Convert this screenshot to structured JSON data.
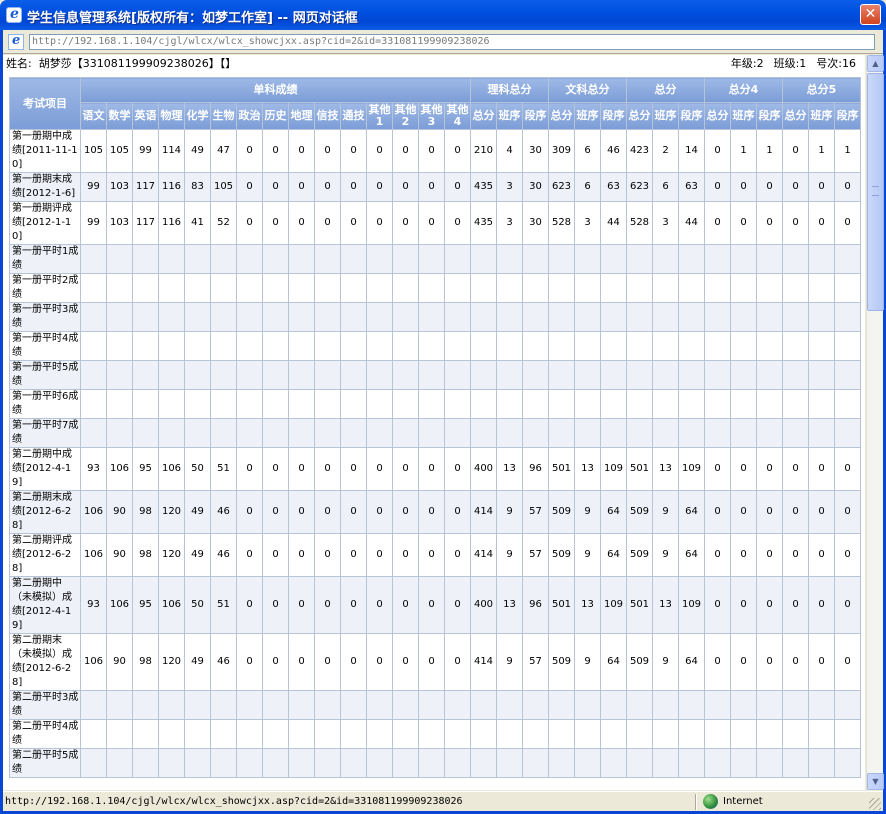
{
  "window": {
    "title": "学生信息管理系统[版权所有：如梦工作室] -- 网页对话框",
    "close_label": "✕"
  },
  "address": {
    "url": "http://192.168.1.104/cjgl/wlcx/wlcx_showcjxx.asp?cid=2&id=331081199909238026"
  },
  "info": {
    "name_label": "姓名:",
    "name_value": "胡梦莎【331081199909238026】【】",
    "grade": "年级:2",
    "class": "班级:1",
    "seat": "号次:16"
  },
  "table": {
    "exam_header": "考试项目",
    "groups": [
      "单科成绩",
      "理科总分",
      "文科总分",
      "总分",
      "总分4",
      "总分5"
    ],
    "subjects": [
      "语文",
      "数学",
      "英语",
      "物理",
      "化学",
      "生物",
      "政治",
      "历史",
      "地理",
      "信技",
      "通技",
      "其他1",
      "其他2",
      "其他3",
      "其他4"
    ],
    "subheads": [
      "总分",
      "班序",
      "段序"
    ],
    "rows": [
      {
        "label": "第一册期中成绩[2011-11-10]",
        "v": [
          "105",
          "105",
          "99",
          "114",
          "49",
          "47",
          "0",
          "0",
          "0",
          "0",
          "0",
          "0",
          "0",
          "0",
          "0",
          "210",
          "4",
          "30",
          "309",
          "6",
          "46",
          "423",
          "2",
          "14",
          "0",
          "1",
          "1",
          "0",
          "1",
          "1"
        ]
      },
      {
        "label": "第一册期末成绩[2012-1-6]",
        "v": [
          "99",
          "103",
          "117",
          "116",
          "83",
          "105",
          "0",
          "0",
          "0",
          "0",
          "0",
          "0",
          "0",
          "0",
          "0",
          "435",
          "3",
          "30",
          "623",
          "6",
          "63",
          "623",
          "6",
          "63",
          "0",
          "0",
          "0",
          "0",
          "0",
          "0"
        ]
      },
      {
        "label": "第一册期评成绩[2012-1-10]",
        "v": [
          "99",
          "103",
          "117",
          "116",
          "41",
          "52",
          "0",
          "0",
          "0",
          "0",
          "0",
          "0",
          "0",
          "0",
          "0",
          "435",
          "3",
          "30",
          "528",
          "3",
          "44",
          "528",
          "3",
          "44",
          "0",
          "0",
          "0",
          "0",
          "0",
          "0"
        ]
      },
      {
        "label": "第一册平时1成绩",
        "v": []
      },
      {
        "label": "第一册平时2成绩",
        "v": []
      },
      {
        "label": "第一册平时3成绩",
        "v": []
      },
      {
        "label": "第一册平时4成绩",
        "v": []
      },
      {
        "label": "第一册平时5成绩",
        "v": []
      },
      {
        "label": "第一册平时6成绩",
        "v": []
      },
      {
        "label": "第一册平时7成绩",
        "v": []
      },
      {
        "label": "第二册期中成绩[2012-4-19]",
        "v": [
          "93",
          "106",
          "95",
          "106",
          "50",
          "51",
          "0",
          "0",
          "0",
          "0",
          "0",
          "0",
          "0",
          "0",
          "0",
          "400",
          "13",
          "96",
          "501",
          "13",
          "109",
          "501",
          "13",
          "109",
          "0",
          "0",
          "0",
          "0",
          "0",
          "0"
        ]
      },
      {
        "label": "第二册期末成绩[2012-6-28]",
        "v": [
          "106",
          "90",
          "98",
          "120",
          "49",
          "46",
          "0",
          "0",
          "0",
          "0",
          "0",
          "0",
          "0",
          "0",
          "0",
          "414",
          "9",
          "57",
          "509",
          "9",
          "64",
          "509",
          "9",
          "64",
          "0",
          "0",
          "0",
          "0",
          "0",
          "0"
        ]
      },
      {
        "label": "第二册期评成绩[2012-6-28]",
        "v": [
          "106",
          "90",
          "98",
          "120",
          "49",
          "46",
          "0",
          "0",
          "0",
          "0",
          "0",
          "0",
          "0",
          "0",
          "0",
          "414",
          "9",
          "57",
          "509",
          "9",
          "64",
          "509",
          "9",
          "64",
          "0",
          "0",
          "0",
          "0",
          "0",
          "0"
        ]
      },
      {
        "label": "第二册期中（未模拟）成绩[2012-4-19]",
        "v": [
          "93",
          "106",
          "95",
          "106",
          "50",
          "51",
          "0",
          "0",
          "0",
          "0",
          "0",
          "0",
          "0",
          "0",
          "0",
          "400",
          "13",
          "96",
          "501",
          "13",
          "109",
          "501",
          "13",
          "109",
          "0",
          "0",
          "0",
          "0",
          "0",
          "0"
        ]
      },
      {
        "label": "第二册期末（未模拟）成绩[2012-6-28]",
        "v": [
          "106",
          "90",
          "98",
          "120",
          "49",
          "46",
          "0",
          "0",
          "0",
          "0",
          "0",
          "0",
          "0",
          "0",
          "0",
          "414",
          "9",
          "57",
          "509",
          "9",
          "64",
          "509",
          "9",
          "64",
          "0",
          "0",
          "0",
          "0",
          "0",
          "0"
        ]
      },
      {
        "label": "第二册平时3成绩",
        "v": []
      },
      {
        "label": "第二册平时4成绩",
        "v": []
      },
      {
        "label": "第二册平时5成绩",
        "v": []
      }
    ]
  },
  "status": {
    "url": "http://192.168.1.104/cjgl/wlcx/wlcx_showcjxx.asp?cid=2&id=331081199909238026",
    "zone": "Internet"
  },
  "icons": {
    "window": "ie-icon",
    "close": "close-icon",
    "zone": "globe-icon"
  }
}
